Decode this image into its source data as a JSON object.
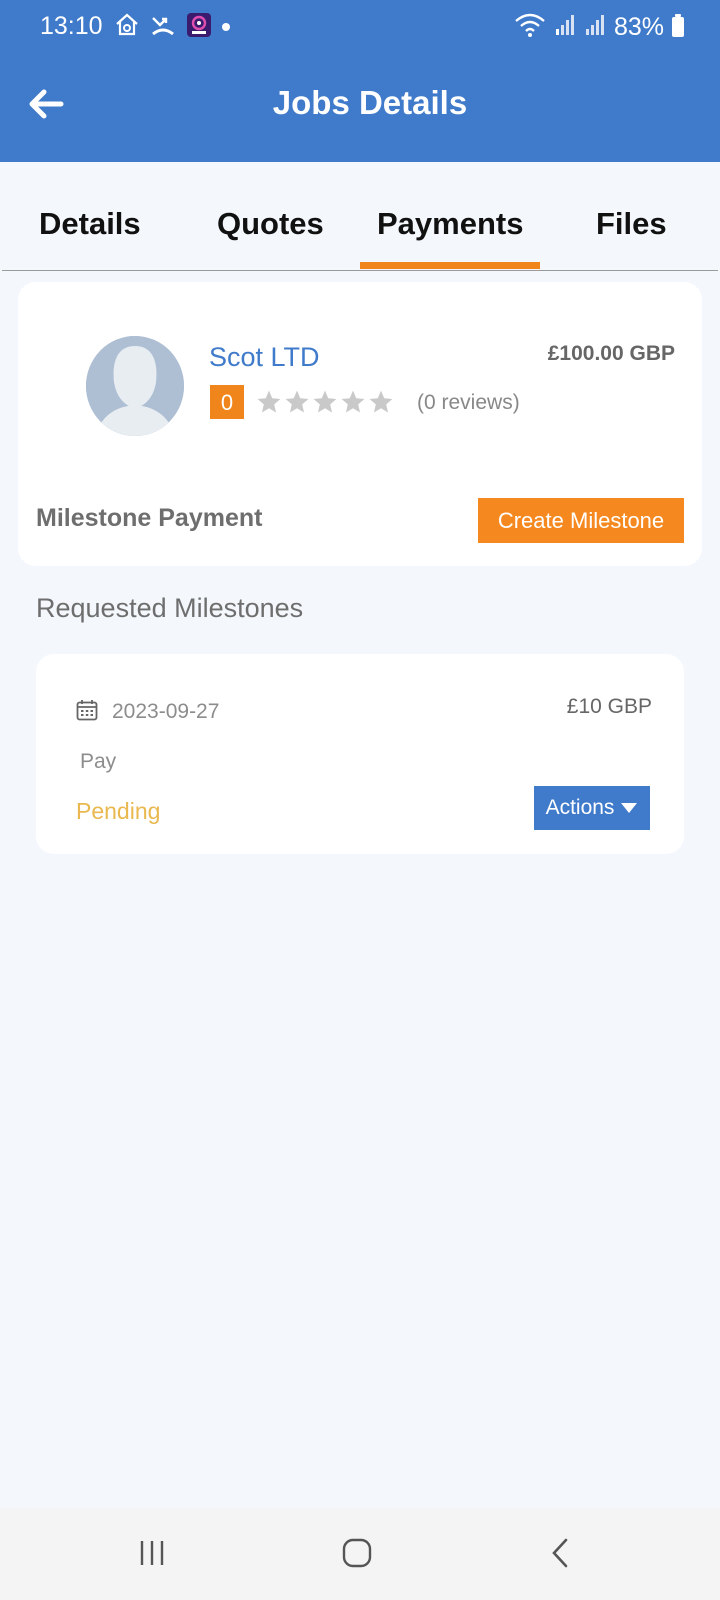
{
  "status_bar": {
    "time": "13:10",
    "battery": "83%",
    "left_icons": [
      "home-sync-icon",
      "missed-call-icon",
      "app-camera-icon",
      "dot-icon"
    ],
    "right_icons": [
      "wifi-icon",
      "signal-icon",
      "signal-icon",
      "battery-icon"
    ]
  },
  "header": {
    "title": "Jobs Details",
    "back_icon": "arrow-left-icon",
    "color": "#3f7acb"
  },
  "tabs": [
    {
      "label": "Details",
      "active": false
    },
    {
      "label": "Quotes",
      "active": false
    },
    {
      "label": "Payments",
      "active": true
    },
    {
      "label": "Files",
      "active": false
    }
  ],
  "accent_color": "#f0861b",
  "provider": {
    "name": "Scot LTD",
    "amount": "£100.00 GBP",
    "rating": "0",
    "stars_filled": 0,
    "stars_total": 5,
    "reviews": "(0 reviews)"
  },
  "milestone_payment": {
    "label": "Milestone Payment",
    "create_button": "Create Milestone"
  },
  "requested": {
    "title": "Requested Milestones",
    "items": [
      {
        "date": "2023-09-27",
        "amount": "£10 GBP",
        "description": "Pay",
        "status": "Pending",
        "status_color": "#e9b84e",
        "actions_label": "Actions"
      }
    ]
  },
  "nav_bar": {
    "buttons": [
      "recent-apps-icon",
      "home-icon",
      "back-icon"
    ]
  }
}
